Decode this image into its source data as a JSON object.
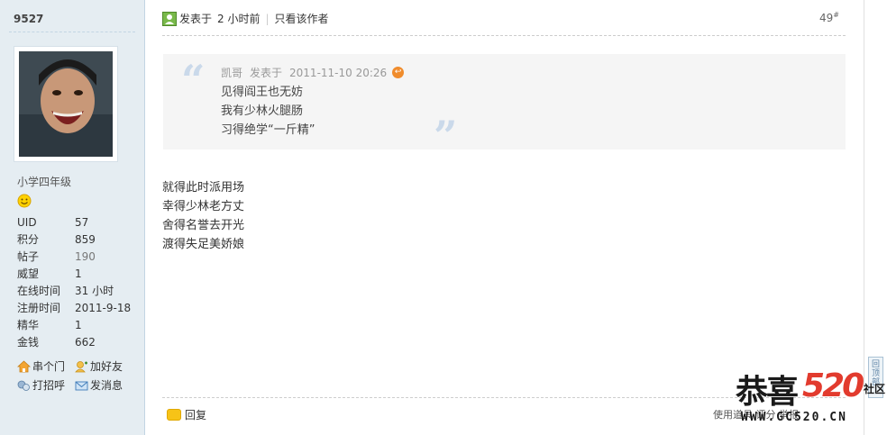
{
  "user": {
    "name": "9527",
    "rank": "小学四年级",
    "stats": [
      {
        "key": "UID",
        "value": "57"
      },
      {
        "key": "积分",
        "value": "859"
      },
      {
        "key": "帖子",
        "value": "190"
      },
      {
        "key": "威望",
        "value": "1"
      },
      {
        "key": "在线时间",
        "value": "31 小时"
      },
      {
        "key": "注册时间",
        "value": "2011-9-18"
      },
      {
        "key": "精华",
        "value": "1"
      },
      {
        "key": "金钱",
        "value": "662"
      }
    ],
    "actions": {
      "visit": "串个门",
      "add_friend": "加好友",
      "greet": "打招呼",
      "message": "发消息"
    }
  },
  "post": {
    "posted_label": "发表于",
    "posted_time": "2 小时前",
    "only_author": "只看该作者",
    "floor": "49",
    "floor_sup": "#",
    "quote": {
      "author": "凯哥",
      "posted_label": "发表于",
      "time": "2011-11-10 20:26",
      "lines": [
        "见得阎王也无妨",
        "我有少林火腿肠",
        "习得绝学“一斤精”"
      ]
    },
    "body": [
      "就得此时派用场",
      "幸得少林老方丈",
      "舍得名誉去开光",
      "渡得失足美娇娘"
    ],
    "reply": "回复",
    "footer_right": "使用道具  评分  举报"
  },
  "back_to_top": "回顶部",
  "watermark": {
    "cn": "恭喜",
    "num": "520",
    "side": "社区",
    "url": "WWW.GC520.CN"
  },
  "colors": {
    "sidebar_bg": "#e5edf2",
    "quote_bg": "#f5f5f5",
    "accent_red": "#e23b2e"
  }
}
